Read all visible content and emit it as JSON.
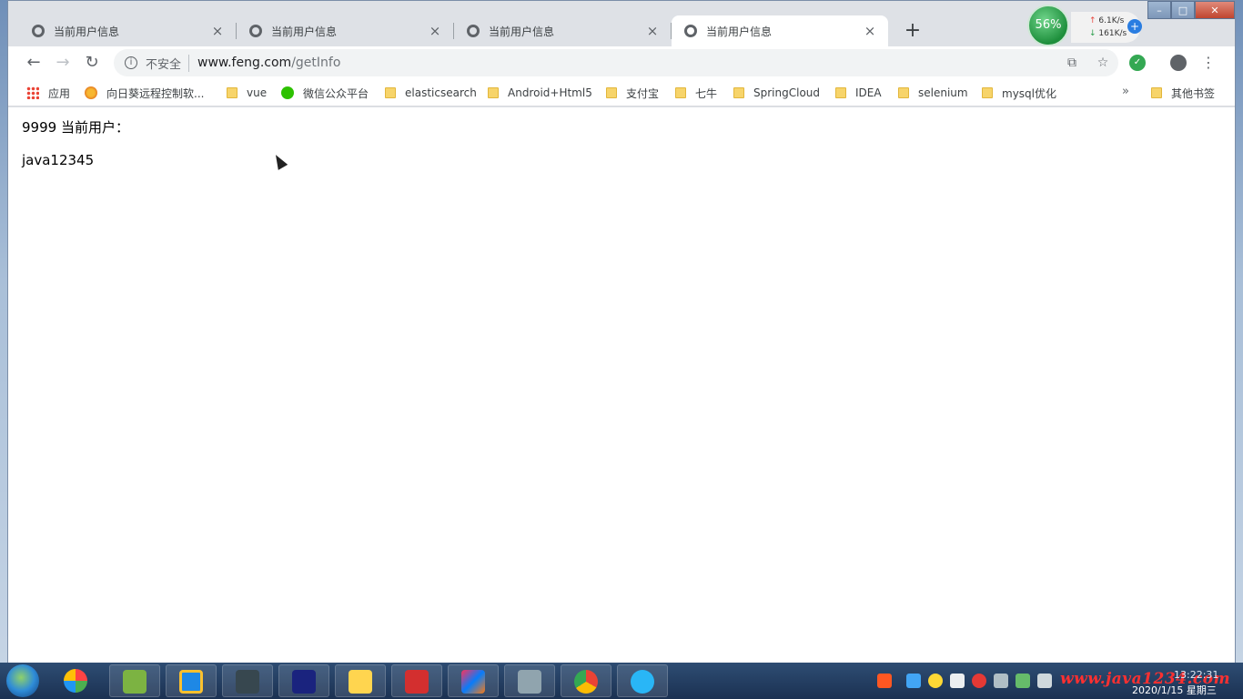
{
  "browser": {
    "tabs": [
      {
        "title": "当前用户信息",
        "active": false
      },
      {
        "title": "当前用户信息",
        "active": false
      },
      {
        "title": "当前用户信息",
        "active": false
      },
      {
        "title": "当前用户信息",
        "active": true
      }
    ],
    "tab_close_glyph": "×",
    "new_tab_glyph": "+",
    "net_widget": {
      "percent": "56%",
      "upload": "6.1K/s",
      "download": "161K/s"
    },
    "address_bar": {
      "security_label": "不安全",
      "host": "www.feng.com",
      "path": "/getInfo"
    },
    "bookmarks": [
      {
        "label": "应用",
        "icon": "apps-grid-icon"
      },
      {
        "label": "向日葵远程控制软...",
        "icon": "sunflower-icon"
      },
      {
        "label": "vue",
        "icon": "folder-icon"
      },
      {
        "label": "微信公众平台",
        "icon": "wechat-icon"
      },
      {
        "label": "elasticsearch",
        "icon": "folder-icon"
      },
      {
        "label": "Android+Html5",
        "icon": "folder-icon"
      },
      {
        "label": "支付宝",
        "icon": "folder-icon"
      },
      {
        "label": "七牛",
        "icon": "folder-icon"
      },
      {
        "label": "SpringCloud",
        "icon": "folder-icon"
      },
      {
        "label": "IDEA",
        "icon": "folder-icon"
      },
      {
        "label": "selenium",
        "icon": "folder-icon"
      },
      {
        "label": "mysql优化",
        "icon": "folder-icon"
      }
    ],
    "bookmarks_more": "»",
    "other_bookmarks": "其他书签"
  },
  "page": {
    "line1": "9999 当前用户：",
    "line2": "java12345"
  },
  "taskbar": {
    "watermark": "www.java1234.com",
    "time": "13:22:31",
    "date": "2020/1/15 星期三"
  },
  "colors": {
    "tabstrip": "#dee1e6",
    "active_tab": "#ffffff",
    "taskbar": "#1b3152",
    "watermark": "#ff3030",
    "net_ball": "#1e8f3c"
  }
}
